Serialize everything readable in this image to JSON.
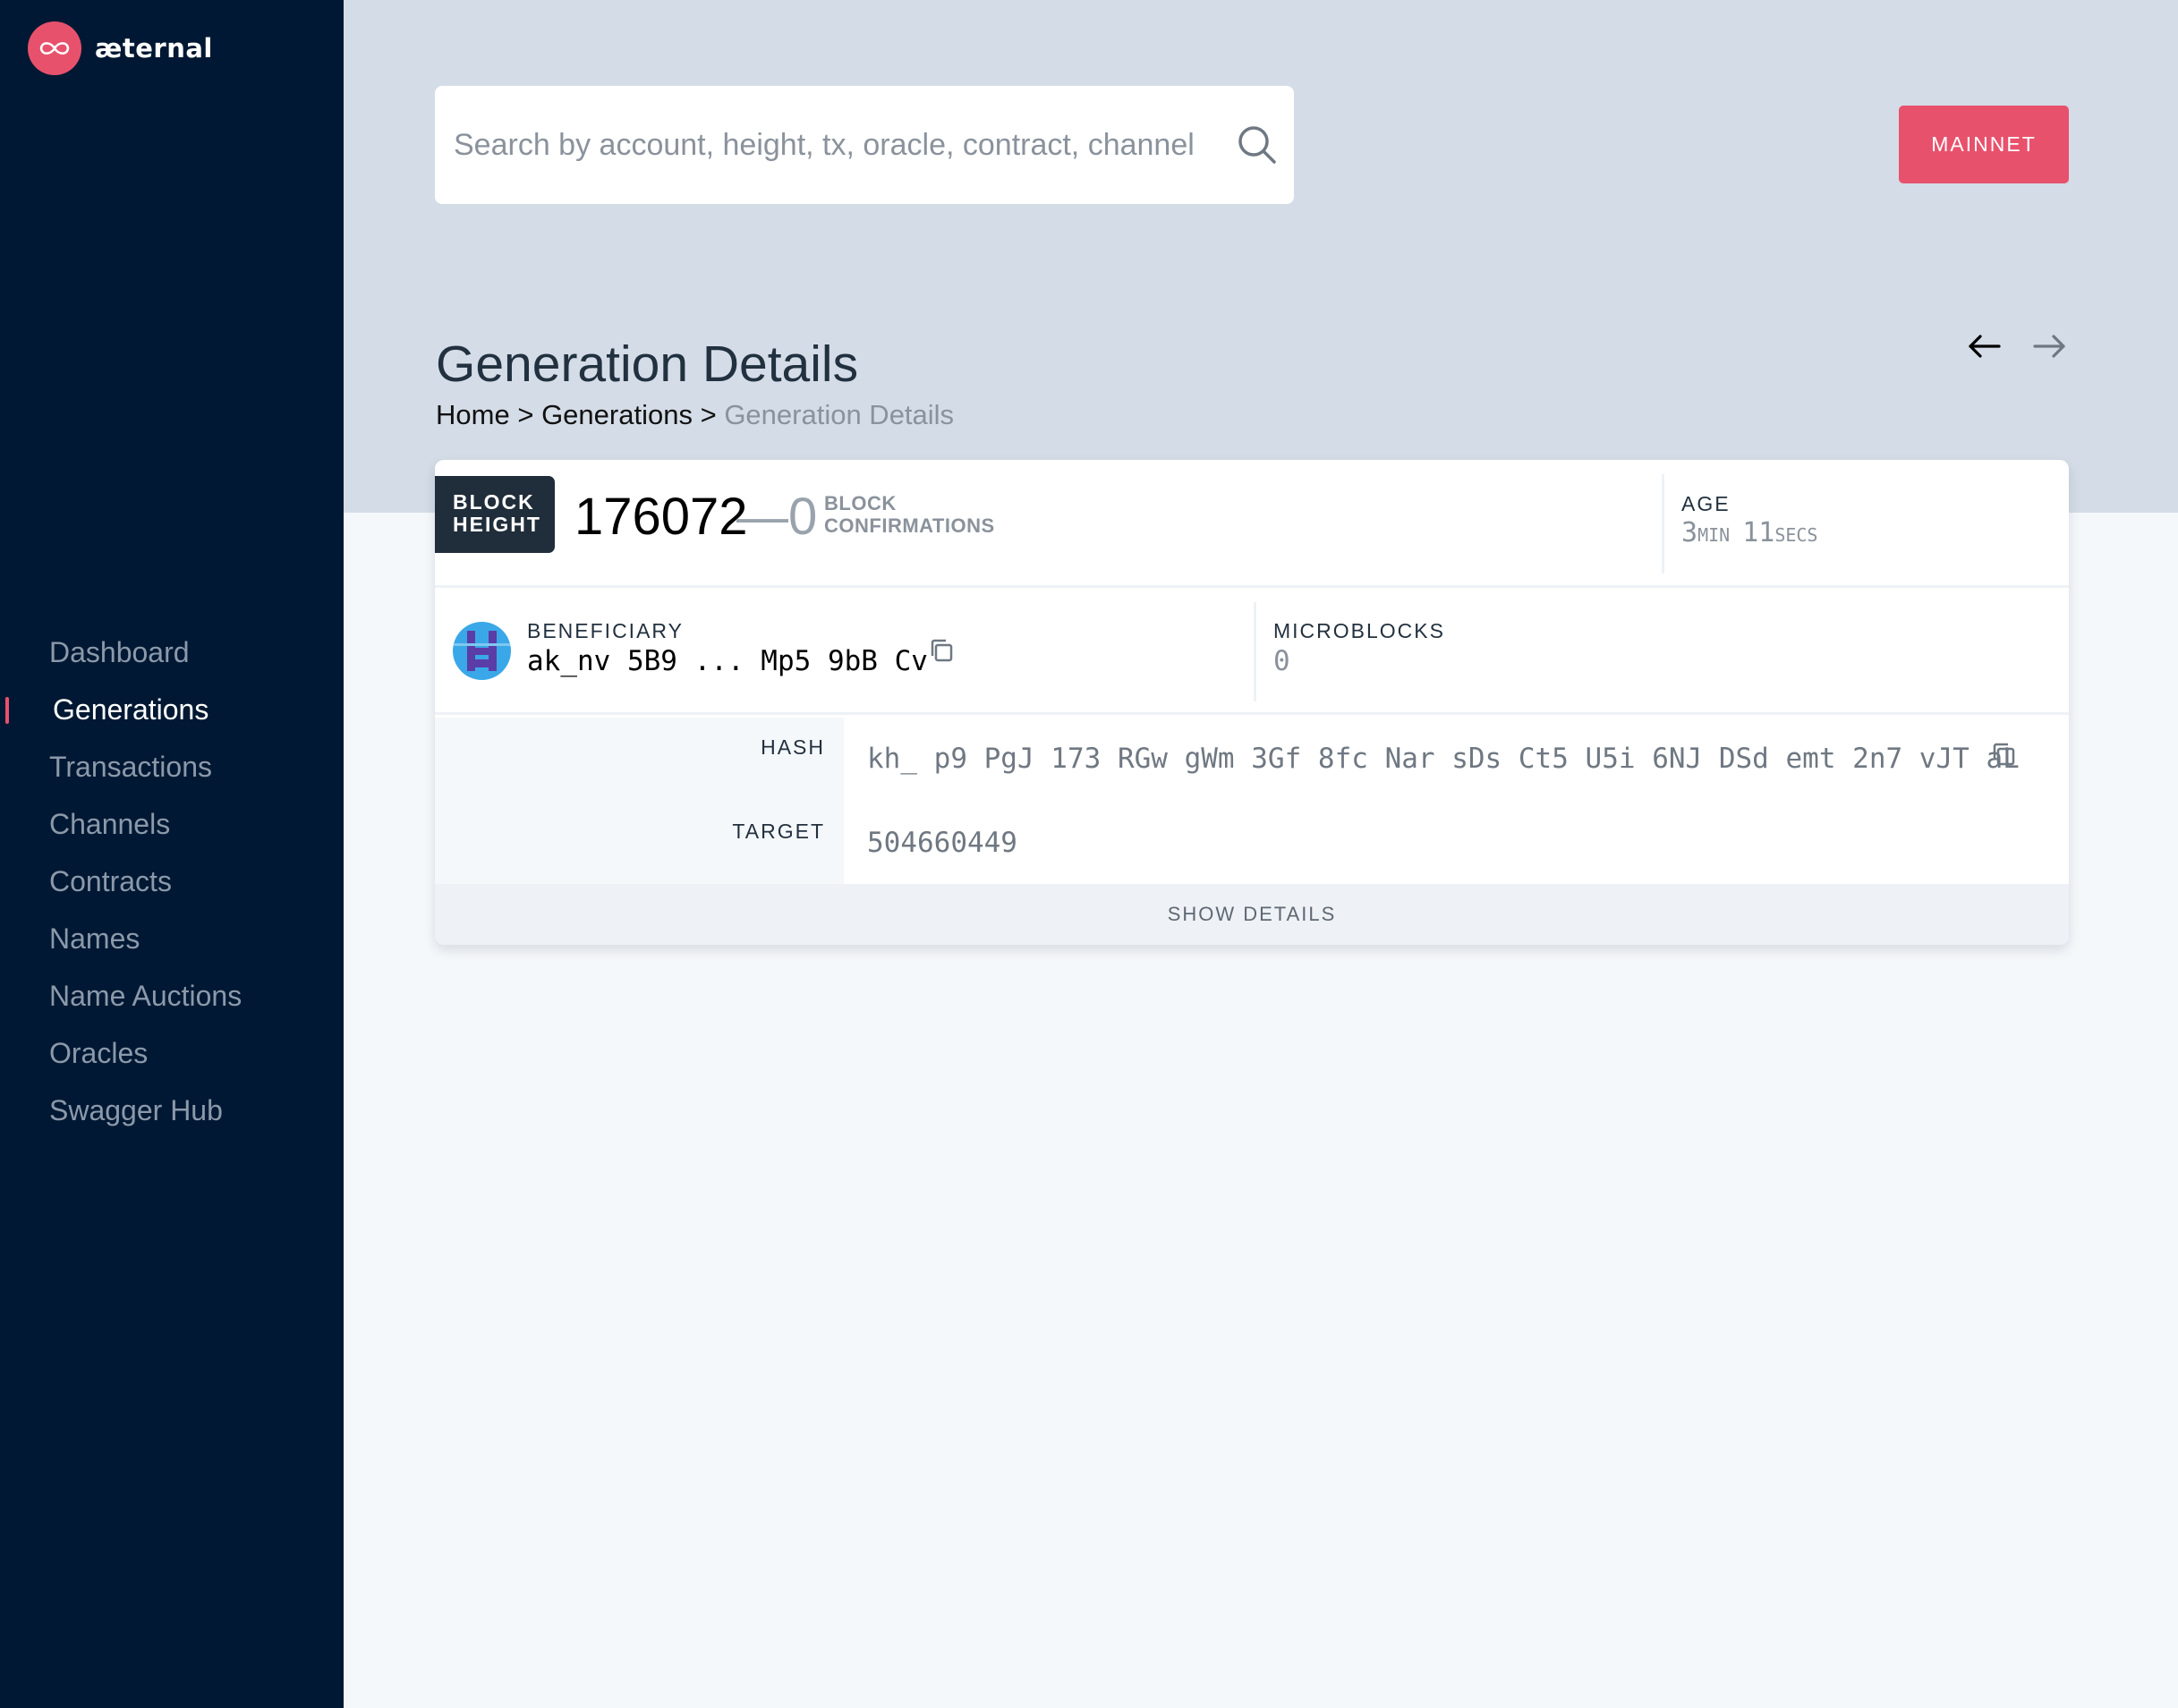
{
  "app": {
    "logo_text": "æternal"
  },
  "sidebar": {
    "items": [
      {
        "label": "Dashboard",
        "active": false
      },
      {
        "label": "Generations",
        "active": true
      },
      {
        "label": "Transactions",
        "active": false
      },
      {
        "label": "Channels",
        "active": false
      },
      {
        "label": "Contracts",
        "active": false
      },
      {
        "label": "Names",
        "active": false
      },
      {
        "label": "Name Auctions",
        "active": false
      },
      {
        "label": "Oracles",
        "active": false
      },
      {
        "label": "Swagger Hub",
        "active": false
      }
    ]
  },
  "search": {
    "placeholder": "Search by account, height, tx, oracle, contract, channel",
    "value": ""
  },
  "network_button": {
    "label": "MAINNET"
  },
  "page": {
    "title": "Generation Details",
    "breadcrumb": {
      "home": "Home",
      "sep": ">",
      "section": "Generations",
      "current": "Generation Details"
    }
  },
  "generation": {
    "block_height_label_1": "BLOCK",
    "block_height_label_2": "HEIGHT",
    "block_height": "176072",
    "dash": "—",
    "confirmations": "0",
    "confirmations_label_1": "BLOCK",
    "confirmations_label_2": "CONFIRMATIONS",
    "age_label": "AGE",
    "age_min": "3",
    "age_min_unit": "MIN",
    "age_sec": "11",
    "age_sec_unit": "SECS",
    "beneficiary_label": "BENEFICIARY",
    "beneficiary": "ak_nv 5B9 ... Mp5 9bB Cv",
    "microblocks_label": "MICROBLOCKS",
    "microblocks": "0",
    "hash_label": "HASH",
    "hash": "kh_ p9 PgJ 173 RGw gWm 3Gf 8fc Nar sDs Ct5 U5i 6NJ DSd emt 2n7 vJT aL",
    "target_label": "TARGET",
    "target": "504660449",
    "show_details_label": "SHOW DETAILS"
  },
  "colors": {
    "sidebar_bg": "#001833",
    "accent": "#e8516c",
    "header_band": "#d4dce7",
    "badge_bg": "#202d3b"
  },
  "icons": {
    "logo": "aeternity-infinity-icon",
    "search": "search-icon",
    "prev": "arrow-left-icon",
    "next": "arrow-right-icon",
    "copy": "copy-icon"
  }
}
